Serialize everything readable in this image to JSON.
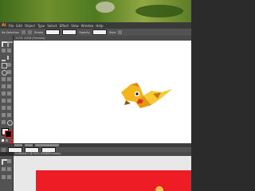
{
  "app": {
    "logo": "Ai"
  },
  "menu": [
    "File",
    "Edit",
    "Object",
    "Type",
    "Select",
    "Effect",
    "View",
    "Window",
    "Help"
  ],
  "control_bar": {
    "no_selection": "No Selection",
    "stroke_label": "Stroke",
    "style_label": "Style",
    "opacity_label": "Opacity"
  },
  "documents": [
    {
      "tab": "1170- 2018 (Preview)"
    },
    {
      "tab": "Untitled-1 @ 50% (RGB/Preview)"
    }
  ],
  "colors": {
    "brand_orange": "#f29c1f",
    "bird_yellow": "#f4b51c",
    "red_artwork": "#ee1c24"
  },
  "icons": [
    "selection-tool-icon",
    "direct-selection-tool-icon",
    "pen-tool-icon",
    "type-tool-icon",
    "rectangle-tool-icon",
    "brush-tool-icon",
    "rotate-tool-icon",
    "scale-tool-icon",
    "eyedropper-tool-icon",
    "zoom-tool-icon",
    "fill-swatch-icon",
    "stroke-swatch-icon"
  ]
}
